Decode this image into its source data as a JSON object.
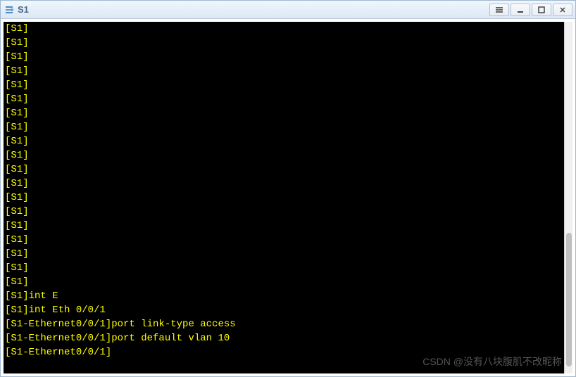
{
  "window": {
    "title": "S1"
  },
  "terminal": {
    "lines": [
      "[S1]",
      "[S1]",
      "[S1]",
      "[S1]",
      "[S1]",
      "[S1]",
      "[S1]",
      "[S1]",
      "[S1]",
      "[S1]",
      "[S1]",
      "[S1]",
      "[S1]",
      "[S1]",
      "[S1]",
      "[S1]",
      "[S1]",
      "[S1]",
      "[S1]",
      "[S1]int E",
      "[S1]int Eth 0/0/1",
      "[S1-Ethernet0/0/1]port link-type access",
      "[S1-Ethernet0/0/1]port default vlan 10",
      "[S1-Ethernet0/0/1]"
    ]
  },
  "watermark": "CSDN @没有八块腹肌不改昵称"
}
